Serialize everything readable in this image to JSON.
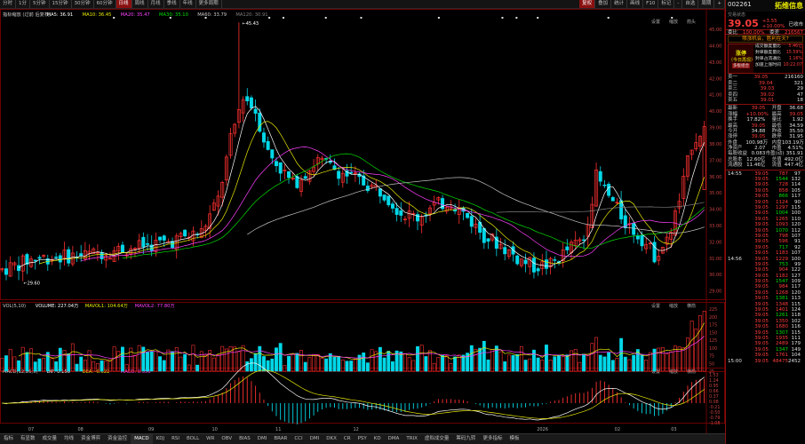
{
  "topbar": {
    "items": [
      "分时",
      "1分",
      "5分钟",
      "15分钟",
      "30分钟",
      "60分钟",
      "日线",
      "周线",
      "月线",
      "季线",
      "年线",
      "更多周期"
    ],
    "active": "日线",
    "right": [
      "复权",
      "叠加",
      "统计",
      "画线",
      "F10",
      "标记",
      "-",
      "自选",
      "周期",
      "+"
    ],
    "right_active": "复权"
  },
  "main": {
    "ma_legend": [
      {
        "text": "指标缩放 (过前 后复权)",
        "color": "#cccccc"
      },
      {
        "text": "MA5: 36.91",
        "color": "#ffffff"
      },
      {
        "text": "MA10: 36.45",
        "color": "#e8e800"
      },
      {
        "text": "MA20: 35.47",
        "color": "#ff40ff"
      },
      {
        "text": "MA30: 35.10",
        "color": "#00e000"
      },
      {
        "text": "MA60: 33.79",
        "color": "#c8c8c8"
      },
      {
        "text": "MA120: 30.91",
        "color": "#808080"
      }
    ],
    "high_label": "45.43",
    "low_label": "29.60",
    "price_axis": [
      "45.00",
      "44.00",
      "43.00",
      "42.00",
      "41.00",
      "40.00",
      "39.00",
      "38.00",
      "37.00",
      "36.00",
      "35.00",
      "34.00",
      "33.00",
      "32.00",
      "31.00",
      "30.00",
      "29.00"
    ],
    "toolbar": [
      "设置",
      "缩放",
      "箭头"
    ]
  },
  "volume": {
    "legend": [
      {
        "text": "VOL(5,10)",
        "color": "#cccccc"
      },
      {
        "text": "VOLUME: 227.04万",
        "color": "#ffffff"
      },
      {
        "text": "MAVOL1: 104.64万",
        "color": "#e8e800"
      },
      {
        "text": "MAVOL2: 77.80万",
        "color": "#ff40ff"
      }
    ],
    "axis": [
      "225",
      "200",
      "175",
      "150",
      "125",
      "100",
      "75",
      "50",
      "25"
    ],
    "toolbar": [
      "设置",
      "缩放",
      "横箭"
    ]
  },
  "macd": {
    "legend": [
      {
        "text": "MACD(12,26,9)",
        "color": "#cccccc"
      },
      {
        "text": "DIF: 0.156",
        "color": "#ffffff"
      },
      {
        "text": "DEA: -0.022",
        "color": "#e8e800"
      },
      {
        "text": "MACD: 0.356",
        "color": "#ff40ff"
      }
    ],
    "axis": [
      "1.53",
      "1.24",
      "0.95",
      "0.66",
      "0.37",
      "0.08",
      "-0.21",
      "-0.50",
      "-0.79",
      "-1.08"
    ],
    "toolbar": [
      "设置",
      "缩放",
      "横箭"
    ]
  },
  "xaxis": {
    "labels": [
      {
        "t": "07",
        "p": 0.04
      },
      {
        "t": "08",
        "p": 0.11
      },
      {
        "t": "09",
        "p": 0.21
      },
      {
        "t": "10",
        "p": 0.3
      },
      {
        "t": "11",
        "p": 0.39
      },
      {
        "t": "12",
        "p": 0.5
      },
      {
        "t": "2026",
        "p": 0.76
      },
      {
        "t": "02",
        "p": 0.87
      },
      {
        "t": "03",
        "p": 0.95
      }
    ]
  },
  "bottombar": {
    "tabs": [
      "指标",
      "有显数",
      "成交量",
      "均线",
      "资金博弈",
      "资金监控",
      "MACD",
      "KDJ",
      "RSI",
      "BOLL",
      "WR",
      "OBV",
      "BIAS",
      "DMI",
      "BRAR",
      "CCI",
      "DMI",
      "DKX",
      "CR",
      "PSY",
      "KD",
      "DMA",
      "TRIX",
      "虚拟成交量",
      "筹码九转",
      "更多指标",
      "模板"
    ],
    "active": "MACD"
  },
  "quote": {
    "code": "002261",
    "name": "拓维信息",
    "price": "39.05",
    "change": "+3.55",
    "pct": "+10.00%",
    "status": "已收市",
    "tag": "交易状态",
    "lines": [
      {
        "l": "委比",
        "v": "100.00%",
        "l2": "委差",
        "v2": "216567"
      }
    ],
    "ai_label": "限涨机会，胜利在天?",
    "banner": [
      "涨停",
      "（今日再现）",
      "多板组合"
    ],
    "banner_right": [
      "成交额度量比",
      "封单额度量比",
      "封单占流通比",
      "加速上涨时间"
    ],
    "banner_right_vals": [
      "5.46亿",
      "15.59%",
      "1.16%",
      "10:22:07"
    ],
    "order_book": [
      [
        "卖一",
        "39.05",
        "216160"
      ],
      [
        "卖二",
        "39.04",
        "321"
      ],
      [
        "卖三",
        "39.03",
        "29"
      ],
      [
        "卖四",
        "39.02",
        "47"
      ],
      [
        "卖五",
        "39.01",
        "18"
      ]
    ],
    "stats": [
      [
        "最新",
        "39.05",
        "开盘",
        "36.68"
      ],
      [
        "涨幅",
        "+10.00%",
        "最高",
        "39.05"
      ],
      [
        "换手",
        "17.82%",
        "量比",
        "1.92"
      ],
      [
        "最高",
        "39.05",
        "最低",
        "34.59"
      ],
      [
        "今开",
        "34.88",
        "昨收",
        "35.50"
      ],
      [
        "涨停",
        "39.05",
        "跌停",
        "31.95"
      ],
      [
        "外盘",
        "100.98万",
        "内盘",
        "103.19万"
      ],
      [
        "净资产",
        "2.07",
        "市盈",
        "4.51%"
      ],
      [
        "每股收益",
        "0.083",
        "市盈(动)",
        "351.91"
      ],
      [
        "总股本",
        "12.60亿",
        "总值",
        "492.0亿"
      ],
      [
        "流通股",
        "11.46亿",
        "流值",
        "447.4亿"
      ]
    ],
    "ticks": [
      [
        "14:55",
        "39.05",
        "787",
        "97"
      ],
      [
        "",
        "39.05",
        "1544",
        "132"
      ],
      [
        "",
        "39.05",
        "728",
        "114"
      ],
      [
        "",
        "39.05",
        "858",
        "105"
      ],
      [
        "",
        "39.05",
        "866",
        "117"
      ],
      [
        "",
        "39.05",
        "1124",
        "90"
      ],
      [
        "",
        "39.05",
        "1297",
        "115"
      ],
      [
        "",
        "39.05",
        "1004",
        "100"
      ],
      [
        "",
        "39.05",
        "1265",
        "110"
      ],
      [
        "",
        "39.05",
        "1093",
        "120"
      ],
      [
        "",
        "39.05",
        "1070",
        "112"
      ],
      [
        "",
        "39.05",
        "798",
        "107"
      ],
      [
        "",
        "39.05",
        "596",
        "91"
      ],
      [
        "",
        "39.05",
        "717",
        "92"
      ],
      [
        "",
        "39.05",
        "1183",
        "107"
      ],
      [
        "14:56",
        "39.05",
        "1229",
        "100"
      ],
      [
        "",
        "39.05",
        "753",
        "99"
      ],
      [
        "",
        "39.05",
        "904",
        "122"
      ],
      [
        "",
        "39.05",
        "1182",
        "127"
      ],
      [
        "",
        "39.05",
        "1547",
        "109"
      ],
      [
        "",
        "39.05",
        "984",
        "117"
      ],
      [
        "",
        "39.05",
        "1268",
        "120"
      ],
      [
        "",
        "39.05",
        "1381",
        "113"
      ],
      [
        "",
        "39.05",
        "1348",
        "115"
      ],
      [
        "",
        "39.05",
        "1401",
        "124"
      ],
      [
        "",
        "39.05",
        "1261",
        "118"
      ],
      [
        "",
        "39.05",
        "1350",
        "102"
      ],
      [
        "",
        "39.05",
        "1680",
        "116"
      ],
      [
        "",
        "39.05",
        "1307",
        "115"
      ],
      [
        "",
        "39.05",
        "1935",
        "111"
      ],
      [
        "",
        "39.05",
        "2489",
        "179"
      ],
      [
        "",
        "39.05",
        "1347",
        "149"
      ],
      [
        "",
        "39.05",
        "1761",
        "104"
      ],
      [
        "15:00",
        "39.05",
        "48475",
        "2452"
      ]
    ]
  }
}
